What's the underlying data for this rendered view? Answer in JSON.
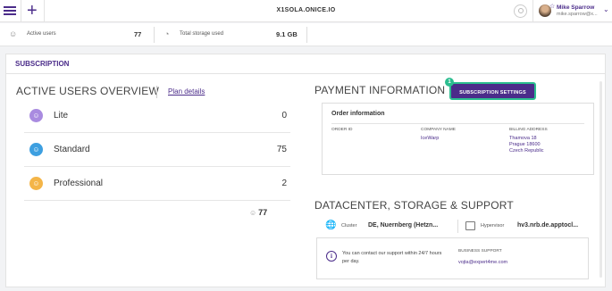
{
  "topbar": {
    "title": "X1SOLA.ONICE.IO",
    "user_name": "Mike Sparrow",
    "user_email": "mike.sparrow@x...",
    "star": "☆",
    "chevron": "⌄"
  },
  "stats": {
    "active_users_label": "Active users",
    "active_users_value": "77",
    "storage_label": "Total storage used",
    "storage_value": "9.1 GB"
  },
  "panel": {
    "title": "SUBSCRIPTION"
  },
  "users_overview": {
    "heading": "ACTIVE USERS OVERVIEW",
    "plan_link": "Plan details",
    "rows": [
      {
        "name": "Lite",
        "count": "0",
        "color": "#a98be0"
      },
      {
        "name": "Standard",
        "count": "75",
        "color": "#3d9fe0"
      },
      {
        "name": "Professional",
        "count": "2",
        "color": "#f4b548"
      }
    ],
    "total": "77"
  },
  "payment": {
    "heading": "PAYMENT INFORMATION",
    "badge": "1",
    "button_label": "SUBSCRIPTION SETTINGS",
    "order_heading": "Order information",
    "order_id_label": "ORDER ID",
    "company_label": "COMPANY NAME",
    "company_value": "IceWarp",
    "billing_label": "BILLING ADDRESS",
    "billing_lines": [
      "Thamova 18",
      "Prague 18600",
      "Czech Republic"
    ]
  },
  "datacenter": {
    "heading": "DATACENTER, STORAGE & SUPPORT",
    "cluster_label": "Cluster",
    "cluster_value": "DE, Nuernberg (Hetzn...",
    "hypervisor_label": "Hypervisor",
    "hypervisor_value": "hv3.nrb.de.apptocl...",
    "support_text": "You can contact our support within 24/7 hours per day.",
    "business_support_label": "BUSINESS SUPPORT",
    "business_support_email": "vojta@expert4me.com"
  },
  "colors": {
    "accent": "#4b2c8a",
    "highlight": "#2bbd8f"
  }
}
